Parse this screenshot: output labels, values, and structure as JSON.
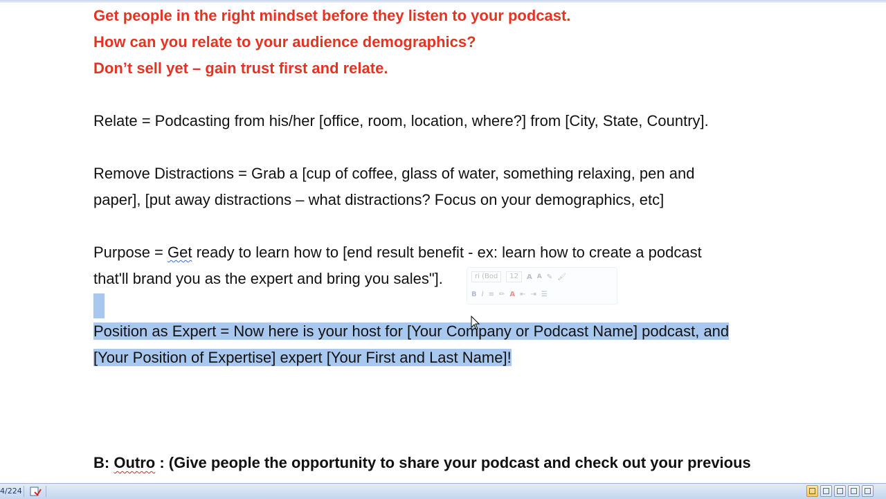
{
  "document": {
    "red_lines": [
      "Get people in the right mindset before they listen to your podcast.",
      "How can you relate to your audience demographics?",
      "Don’t sell yet – gain trust first and relate."
    ],
    "relate_line": "Relate = Podcasting from his/her [office, room, location, where?] from [City, State, Country].",
    "remove_line_1": "Remove Distractions = Grab a [cup of coffee, glass of water, something relaxing, pen and",
    "remove_line_2": "paper], [put away distractions – what distractions?  Focus on your demographics, etc]",
    "purpose_line_1_before": "Purpose = ",
    "purpose_line_1_word": "Get",
    "purpose_line_1_after": " ready to learn how to [end result benefit - ex: learn how to create a podcast",
    "purpose_line_2": "that'll brand you as the expert and bring you sales\"].",
    "position_line_1": "Position as Expert = Now here is your host for [Your Company or Podcast Name] podcast, and",
    "position_line_2": "[Your Position of Expertise] expert [Your First and Last Name]!  ",
    "outro_prefix": "B:  ",
    "outro_word": "Outro",
    "outro_after": " :  (Give people the opportunity to share your podcast and check out your previous"
  },
  "mini_toolbar": {
    "font_name": "ri (Bod",
    "font_size": "12",
    "grow_font": "A",
    "shrink_font": "A",
    "bold": "B",
    "italic": "I",
    "font_color": "A"
  },
  "statusbar": {
    "page_count": "4/224"
  },
  "colors": {
    "heading_red": "#e53323",
    "selection": "#a9c8ef",
    "body_text": "#111111"
  }
}
